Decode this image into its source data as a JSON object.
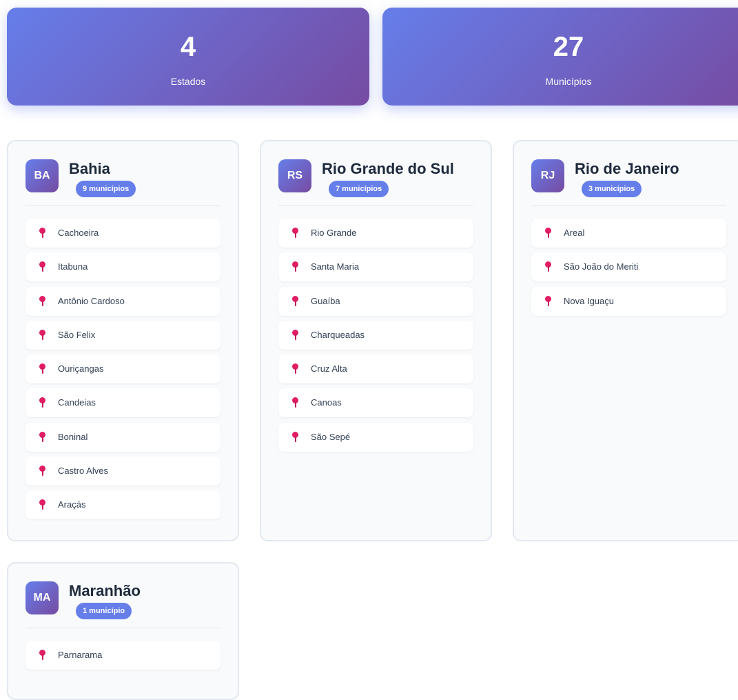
{
  "stats": [
    {
      "value": "4",
      "label": "Estados"
    },
    {
      "value": "27",
      "label": "Municípios"
    }
  ],
  "states": [
    {
      "abbr": "BA",
      "name": "Bahia",
      "count_label": "9 municípios",
      "cities": [
        "Cachoeira",
        "Itabuna",
        "Antônio Cardoso",
        "São Felix",
        "Ouriçangas",
        "Candeias",
        "Boninal",
        "Castro Alves",
        "Araçás"
      ]
    },
    {
      "abbr": "RS",
      "name": "Rio Grande do Sul",
      "count_label": "7 municípios",
      "cities": [
        "Rio Grande",
        "Santa Maria",
        "Guaíba",
        "Charqueadas",
        "Cruz Alta",
        "Canoas",
        "São Sepé"
      ]
    },
    {
      "abbr": "RJ",
      "name": "Rio de Janeiro",
      "count_label": "3 municípios",
      "cities": [
        "Areal",
        "São João do Meriti",
        "Nova Iguaçu"
      ]
    },
    {
      "abbr": "MA",
      "name": "Maranhão",
      "count_label": "1 município",
      "cities": [
        "Parnarama"
      ]
    }
  ],
  "icons": {
    "city_marker": "map-pin-icon"
  },
  "colors": {
    "gradient_start": "#667eea",
    "gradient_end": "#764ba2",
    "pin": "#e11d63"
  }
}
